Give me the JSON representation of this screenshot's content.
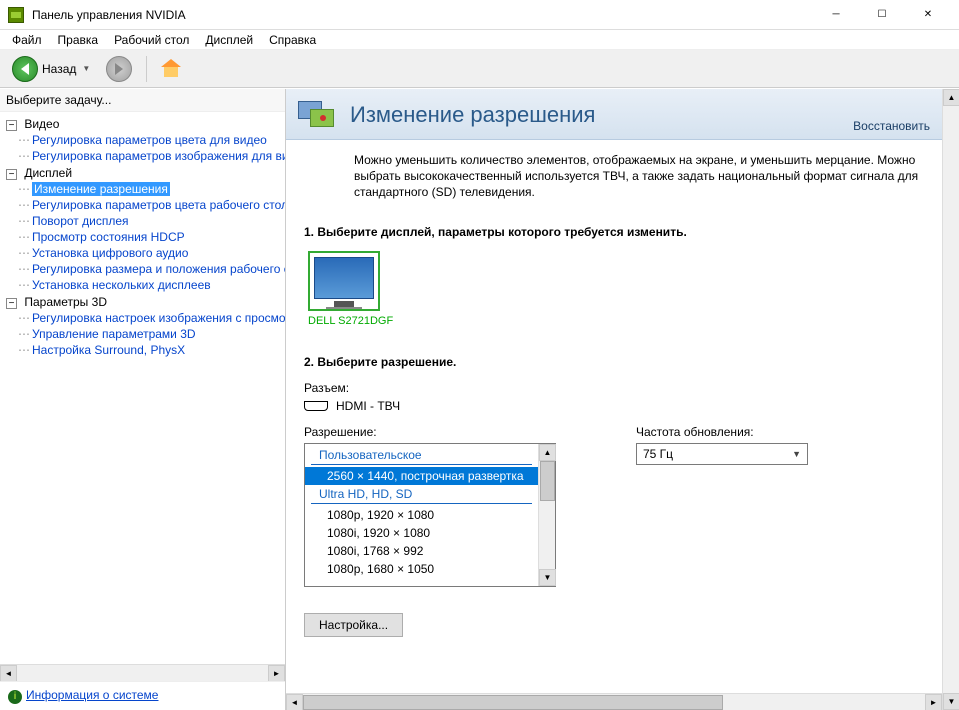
{
  "window": {
    "title": "Панель управления NVIDIA"
  },
  "menu": {
    "file": "Файл",
    "edit": "Правка",
    "desktop": "Рабочий стол",
    "display": "Дисплей",
    "help": "Справка"
  },
  "toolbar": {
    "back_label": "Назад"
  },
  "sidebar": {
    "header": "Выберите задачу...",
    "groups": [
      {
        "label": "Видео",
        "items": [
          "Регулировка параметров цвета для видео",
          "Регулировка параметров изображения для видео"
        ]
      },
      {
        "label": "Дисплей",
        "items": [
          "Изменение разрешения",
          "Регулировка параметров цвета рабочего стола",
          "Поворот дисплея",
          "Просмотр состояния HDCP",
          "Установка цифрового аудио",
          "Регулировка размера и положения рабочего стола",
          "Установка нескольких дисплеев"
        ]
      },
      {
        "label": "Параметры 3D",
        "items": [
          "Регулировка настроек изображения с просмотром",
          "Управление параметрами 3D",
          "Настройка Surround, PhysX"
        ]
      }
    ],
    "selected": "Изменение разрешения",
    "footer_link": "Информация о системе"
  },
  "content": {
    "title": "Изменение разрешения",
    "restore": "Восстановить",
    "description": "Можно уменьшить количество элементов, отображаемых на экране, и уменьшить мерцание. Можно выбрать высококачественный используется ТВЧ, а также задать национальный формат сигнала для стандартного (SD) телевидения.",
    "step1_title": "1. Выберите дисплей, параметры которого требуется изменить.",
    "display_name": "DELL S2721DGF",
    "step2_title": "2. Выберите разрешение.",
    "connector_label": "Разъем:",
    "connector_value": "HDMI - ТВЧ",
    "resolution_label": "Разрешение:",
    "refresh_label": "Частота обновления:",
    "refresh_value": "75 Гц",
    "res_list": {
      "cat1": "Пользовательское",
      "cat2": "Ultra HD, HD, SD",
      "items_custom": [
        "2560 × 1440, построчная развертка"
      ],
      "items_hd": [
        "1080p, 1920 × 1080",
        "1080i, 1920 × 1080",
        "1080i, 1768 × 992",
        "1080p, 1680 × 1050"
      ]
    },
    "settings_button": "Настройка..."
  }
}
